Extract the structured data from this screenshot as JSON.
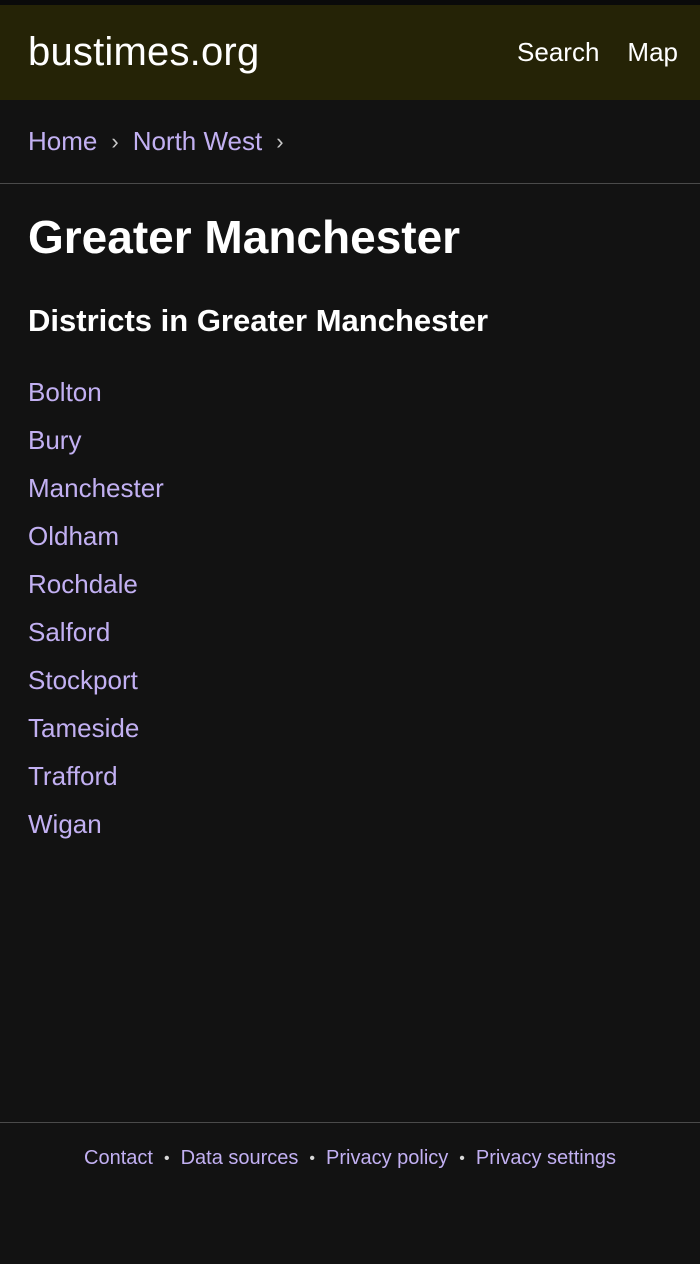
{
  "header": {
    "site_title": "bustimes.org",
    "nav": [
      "Search",
      "Map"
    ]
  },
  "breadcrumb": {
    "items": [
      "Home",
      "North West"
    ],
    "separator": "›"
  },
  "main": {
    "title": "Greater Manchester",
    "section_title": "Districts in Greater Manchester",
    "districts": [
      "Bolton",
      "Bury",
      "Manchester",
      "Oldham",
      "Rochdale",
      "Salford",
      "Stockport",
      "Tameside",
      "Trafford",
      "Wigan"
    ]
  },
  "footer": {
    "links": [
      "Contact",
      "Data sources",
      "Privacy policy",
      "Privacy settings"
    ],
    "separator": "•"
  },
  "colors": {
    "background": "#121212",
    "header_background": "#252306",
    "link": "#c2b0f2",
    "text": "#ffffff",
    "divider": "#4a4a4a"
  }
}
